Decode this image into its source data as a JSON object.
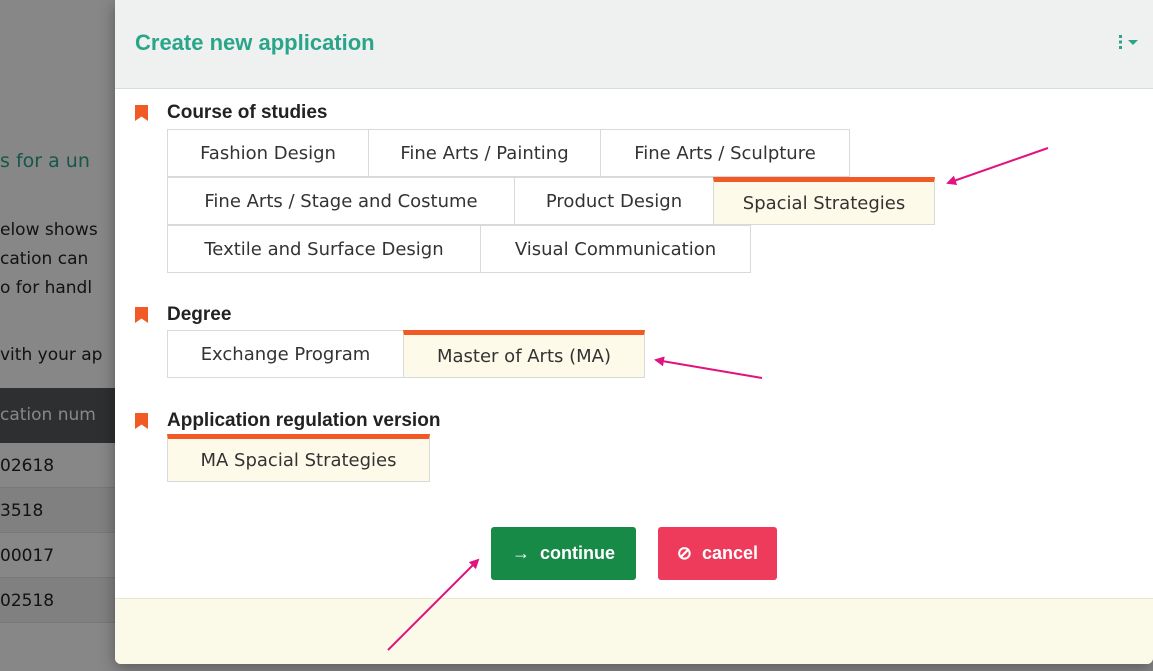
{
  "background": {
    "heading": "s for a un",
    "paragraph_lines": [
      "elow shows",
      "cation can",
      "o for handl",
      "",
      "vith your ap"
    ],
    "table_header": "cation num",
    "rows": [
      "02618",
      "3518",
      "00017",
      "02518"
    ]
  },
  "modal": {
    "title": "Create new application",
    "menu_icon": "more-vertical-dropdown-icon",
    "sections": {
      "course": {
        "label": "Course of studies",
        "rows": [
          [
            {
              "label": "Fashion Design",
              "selected": false
            },
            {
              "label": "Fine Arts / Painting",
              "selected": false
            },
            {
              "label": "Fine Arts / Sculpture",
              "selected": false
            }
          ],
          [
            {
              "label": "Fine Arts / Stage and Costume",
              "selected": false
            },
            {
              "label": "Product Design",
              "selected": false
            },
            {
              "label": "Spacial Strategies",
              "selected": true
            }
          ],
          [
            {
              "label": "Textile and Surface Design",
              "selected": false
            },
            {
              "label": "Visual Communication",
              "selected": false
            }
          ]
        ]
      },
      "degree": {
        "label": "Degree",
        "options": [
          {
            "label": "Exchange Program",
            "selected": false
          },
          {
            "label": "Master of Arts (MA)",
            "selected": true
          }
        ]
      },
      "regulation": {
        "label": "Application regulation version",
        "options": [
          {
            "label": "MA Spacial Strategies",
            "selected": true
          }
        ]
      }
    },
    "buttons": {
      "continue": {
        "label": "continue",
        "icon": "arrow-right-icon"
      },
      "cancel": {
        "label": "cancel",
        "icon": "cancel-circle-icon"
      }
    }
  },
  "colors": {
    "accent": "#2aa58a",
    "selected_marker": "#f15a24",
    "continue": "#178a47",
    "cancel": "#ee3b5c",
    "annotation_arrow": "#e2127f"
  }
}
